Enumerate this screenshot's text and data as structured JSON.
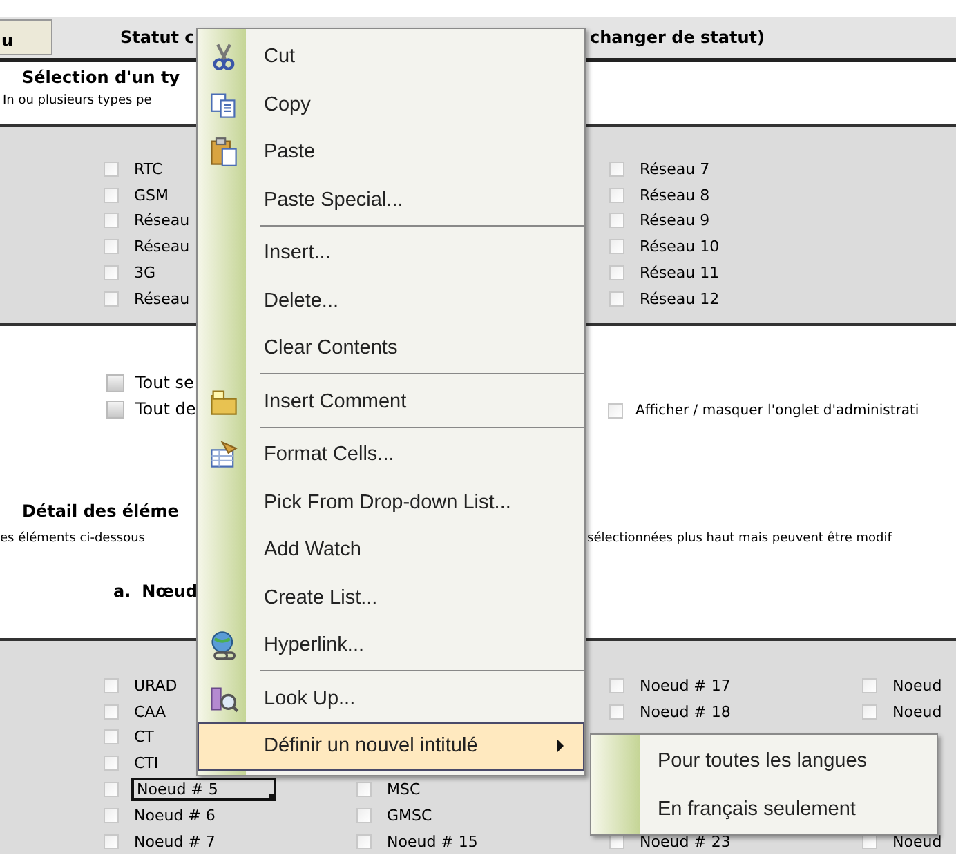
{
  "toolbar": {
    "button": "u",
    "status_label": "Statut c",
    "status_hint": "changer de statut)"
  },
  "selection": {
    "title": "Sélection d'un ty",
    "subtitle": "In ou plusieurs types pe",
    "columns": [
      {
        "top": [
          {
            "label": "RTC",
            "checked": false
          },
          {
            "label": "GSM",
            "checked": false
          },
          {
            "label": "Réseau",
            "checked": false
          },
          {
            "label": "Réseau",
            "checked": false
          },
          {
            "label": "3G",
            "checked": false
          },
          {
            "label": "Réseau",
            "checked": false
          }
        ]
      },
      {},
      {
        "top": [
          {
            "label": "Réseau 7",
            "checked": false
          },
          {
            "label": "Réseau 8",
            "checked": false
          },
          {
            "label": "Réseau 9",
            "checked": false
          },
          {
            "label": "Réseau 10",
            "checked": false
          },
          {
            "label": "Réseau 11",
            "checked": false
          },
          {
            "label": "Réseau 12",
            "checked": false
          }
        ]
      }
    ]
  },
  "bulk_buttons": [
    "Tout se",
    "Tout de"
  ],
  "admin_toggle": {
    "label": "Afficher / masquer l'onglet d'administrati",
    "checked": false
  },
  "detail": {
    "title": "Détail des éléme",
    "note_left": "es éléments ci-dessous",
    "note_right": "sélectionnées plus haut mais peuvent être modif",
    "letter": "a.",
    "subtitle": "Nœud",
    "columns": [
      {
        "top": [
          {
            "label": "URAD",
            "checked": false,
            "selected": false
          },
          {
            "label": "CAA",
            "checked": false,
            "selected": false
          },
          {
            "label": "CT",
            "checked": false,
            "selected": false
          },
          {
            "label": "CTI",
            "checked": false,
            "selected": false
          },
          {
            "label": "Noeud # 5",
            "checked": false,
            "selected": true
          },
          {
            "label": "Noeud # 6",
            "checked": false,
            "selected": false
          },
          {
            "label": "Noeud # 7",
            "checked": false,
            "selected": false
          }
        ]
      },
      {
        "bottom": [
          {
            "label": "MSC",
            "checked": false,
            "selected": false
          },
          {
            "label": "GMSC",
            "checked": false,
            "selected": false
          },
          {
            "label": "Noeud # 15",
            "checked": false,
            "selected": false
          }
        ]
      },
      {
        "top": [
          {
            "label": "Noeud # 17",
            "checked": false,
            "selected": false
          },
          {
            "label": "Noeud # 18",
            "checked": false,
            "selected": false
          }
        ],
        "bottom": [
          {
            "label": "Noeud # 23",
            "checked": false,
            "selected": false
          }
        ]
      },
      {
        "top": [
          {
            "label": "Noeud",
            "checked": false,
            "selected": false
          },
          {
            "label": "Noeud",
            "checked": false,
            "selected": false
          }
        ],
        "bottom": [
          {
            "label": "Noeud",
            "checked": false,
            "selected": false
          }
        ]
      }
    ]
  },
  "context_menu": {
    "items": [
      {
        "kind": "item",
        "label": "Cut",
        "selected": false
      },
      {
        "kind": "item",
        "label": "Copy",
        "selected": false
      },
      {
        "kind": "item",
        "label": "Paste",
        "selected": false
      },
      {
        "kind": "item",
        "label": "Paste Special...",
        "selected": false
      },
      {
        "kind": "separator"
      },
      {
        "kind": "item",
        "label": "Insert...",
        "selected": false
      },
      {
        "kind": "item",
        "label": "Delete...",
        "selected": false
      },
      {
        "kind": "item",
        "label": "Clear Contents",
        "selected": false
      },
      {
        "kind": "separator"
      },
      {
        "kind": "item",
        "label": "Insert Comment",
        "selected": false
      },
      {
        "kind": "separator"
      },
      {
        "kind": "item",
        "label": "Format Cells...",
        "selected": false
      },
      {
        "kind": "item",
        "label": "Pick From Drop-down List...",
        "selected": false
      },
      {
        "kind": "item",
        "label": "Add Watch",
        "selected": false
      },
      {
        "kind": "item",
        "label": "Create List...",
        "selected": false
      },
      {
        "kind": "item",
        "label": "Hyperlink...",
        "selected": false
      },
      {
        "kind": "separator"
      },
      {
        "kind": "item",
        "label": "Look Up...",
        "selected": false
      },
      {
        "kind": "submenu",
        "label": "Définir un nouvel intitulé",
        "selected": true
      }
    ],
    "submenu": [
      {
        "label": "Pour toutes les langues",
        "selected": false
      },
      {
        "label": "En français seulement",
        "selected": false
      }
    ]
  }
}
